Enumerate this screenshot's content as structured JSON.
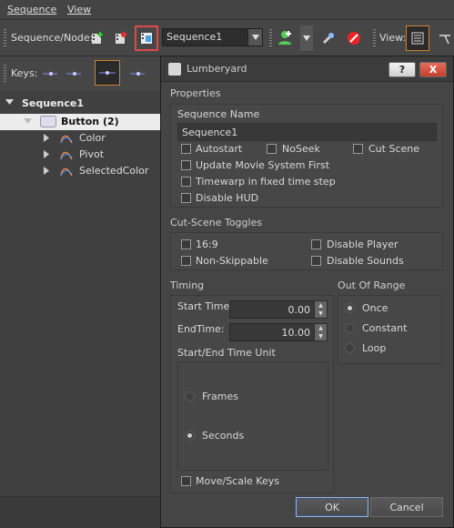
{
  "menu": {
    "sequence": "Sequence",
    "view": "View"
  },
  "toolbar": {
    "seq_node_label": "Sequence/Node:",
    "sequence_combo": "Sequence1",
    "view_label": "View:",
    "keys_label": "Keys:"
  },
  "tree": {
    "root": "Sequence1",
    "node": "Button (2)",
    "children": [
      "Color",
      "Pivot",
      "SelectedColor"
    ]
  },
  "dialog": {
    "title": "Lumberyard",
    "help_btn": "?",
    "close_btn": "X",
    "properties": {
      "header": "Properties",
      "name_label": "Sequence Name",
      "name_value": "Sequence1",
      "autostart": "Autostart",
      "noseek": "NoSeek",
      "cutscene": "Cut Scene",
      "update_movie": "Update Movie System First",
      "timewarp": "Timewarp in fixed time step",
      "disable_hud": "Disable HUD"
    },
    "cutscene_toggles": {
      "header": "Cut-Scene Toggles",
      "ratio": "16:9",
      "disable_player": "Disable Player",
      "non_skippable": "Non-Skippable",
      "disable_sounds": "Disable Sounds"
    },
    "timing": {
      "header": "Timing",
      "start_label": "Start Time:",
      "start_value": "0.00",
      "end_label": "EndTime:",
      "end_value": "10.00",
      "unit_header": "Start/End Time Unit",
      "frames": "Frames",
      "seconds": "Seconds",
      "move_scale": "Move/Scale Keys"
    },
    "out_of_range": {
      "header": "Out Of Range",
      "once": "Once",
      "constant": "Constant",
      "loop": "Loop"
    },
    "ok": "OK",
    "cancel": "Cancel"
  }
}
